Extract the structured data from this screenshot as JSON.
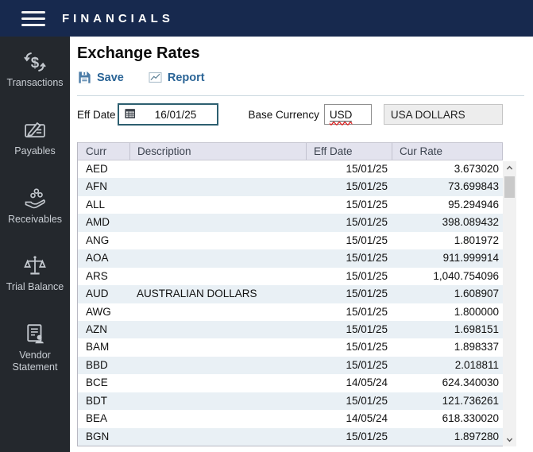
{
  "app": {
    "title": "FINANCIALS"
  },
  "sidebar": {
    "items": [
      {
        "label": "Transactions",
        "icon": "transactions-icon"
      },
      {
        "label": "Payables",
        "icon": "payables-icon"
      },
      {
        "label": "Receivables",
        "icon": "receivables-icon"
      },
      {
        "label": "Trial Balance",
        "icon": "trial-balance-icon"
      },
      {
        "label": "Vendor Statement",
        "icon": "vendor-statement-icon"
      }
    ]
  },
  "page": {
    "title": "Exchange Rates"
  },
  "toolbar": {
    "save_label": "Save",
    "report_label": "Report"
  },
  "form": {
    "eff_date_label": "Eff Date",
    "eff_date_value": "16/01/25",
    "base_currency_label": "Base Currency",
    "base_currency_code": "USD",
    "base_currency_name": "USA DOLLARS"
  },
  "table": {
    "columns": [
      "Curr",
      "Description",
      "Eff Date",
      "Cur Rate"
    ],
    "rows": [
      {
        "curr": "AED",
        "description": "",
        "eff_date": "15/01/25",
        "cur_rate": "3.673020"
      },
      {
        "curr": "AFN",
        "description": "",
        "eff_date": "15/01/25",
        "cur_rate": "73.699843"
      },
      {
        "curr": "ALL",
        "description": "",
        "eff_date": "15/01/25",
        "cur_rate": "95.294946"
      },
      {
        "curr": "AMD",
        "description": "",
        "eff_date": "15/01/25",
        "cur_rate": "398.089432"
      },
      {
        "curr": "ANG",
        "description": "",
        "eff_date": "15/01/25",
        "cur_rate": "1.801972"
      },
      {
        "curr": "AOA",
        "description": "",
        "eff_date": "15/01/25",
        "cur_rate": "911.999914"
      },
      {
        "curr": "ARS",
        "description": "",
        "eff_date": "15/01/25",
        "cur_rate": "1,040.754096"
      },
      {
        "curr": "AUD",
        "description": "AUSTRALIAN DOLLARS",
        "eff_date": "15/01/25",
        "cur_rate": "1.608907"
      },
      {
        "curr": "AWG",
        "description": "",
        "eff_date": "15/01/25",
        "cur_rate": "1.800000"
      },
      {
        "curr": "AZN",
        "description": "",
        "eff_date": "15/01/25",
        "cur_rate": "1.698151"
      },
      {
        "curr": "BAM",
        "description": "",
        "eff_date": "15/01/25",
        "cur_rate": "1.898337"
      },
      {
        "curr": "BBD",
        "description": "",
        "eff_date": "15/01/25",
        "cur_rate": "2.018811"
      },
      {
        "curr": "BCE",
        "description": "",
        "eff_date": "14/05/24",
        "cur_rate": "624.340030"
      },
      {
        "curr": "BDT",
        "description": "",
        "eff_date": "15/01/25",
        "cur_rate": "121.736261"
      },
      {
        "curr": "BEA",
        "description": "",
        "eff_date": "14/05/24",
        "cur_rate": "618.330020"
      },
      {
        "curr": "BGN",
        "description": "",
        "eff_date": "15/01/25",
        "cur_rate": "1.897280"
      }
    ]
  },
  "colors": {
    "header_bg": "#17294e",
    "sidebar_bg": "#24282d",
    "accent_blue": "#2a6496",
    "table_header_bg": "#e3e3ee",
    "alt_row_bg": "#e9f0f5",
    "date_field_border": "#2d5f70",
    "spellcheck_red": "#dd2222"
  }
}
